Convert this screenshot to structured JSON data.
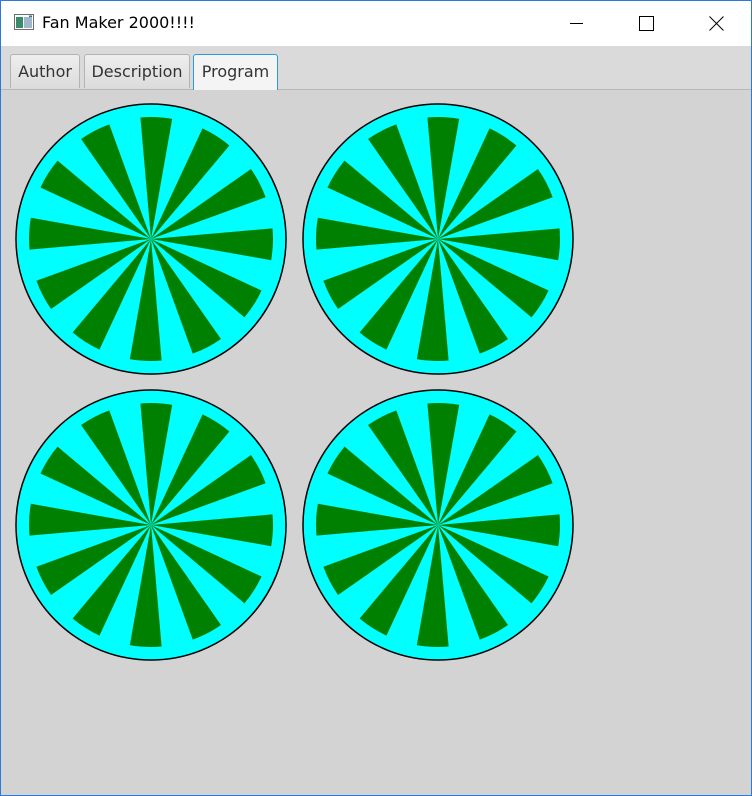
{
  "window": {
    "title": "Fan Maker 2000!!!!",
    "icon": "app-window-icon"
  },
  "titlebar_buttons": {
    "minimize_icon": "minimize-icon",
    "maximize_icon": "maximize-icon",
    "close_icon": "close-icon"
  },
  "tabs": [
    {
      "label": "Author",
      "selected": false
    },
    {
      "label": "Description",
      "selected": false
    },
    {
      "label": "Program",
      "selected": true
    }
  ],
  "fans": {
    "count": 4,
    "blades_per_fan": 12,
    "colors": {
      "housing": "#00ffff",
      "blade": "#008000",
      "outline": "#000000",
      "background": "#d3d3d3"
    }
  }
}
